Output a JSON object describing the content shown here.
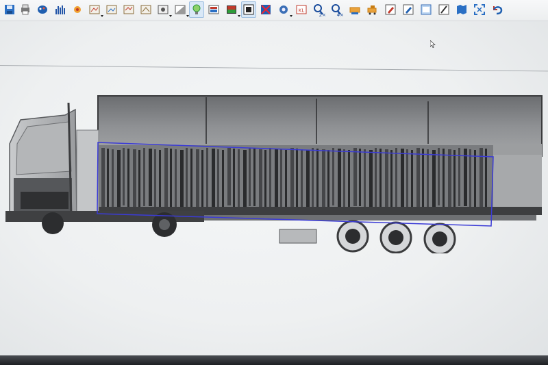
{
  "toolbar": {
    "buttons": [
      {
        "name": "save-icon",
        "color": "#2a6fc4"
      },
      {
        "name": "print-icon",
        "color": "#555"
      },
      {
        "name": "palette-icon",
        "color": "#1f5fb0"
      },
      {
        "name": "histogram-icon",
        "color": "#2456a8"
      },
      {
        "name": "edge-enhance-icon",
        "color": "#c0392b"
      },
      {
        "name": "filter-1-icon",
        "color": "#8a6d3b"
      },
      {
        "name": "filter-2-icon",
        "color": "#8a6d3b"
      },
      {
        "name": "filter-3-icon",
        "color": "#8a6d3b"
      },
      {
        "name": "filter-4-icon",
        "color": "#8a6d3b"
      },
      {
        "name": "sharpen-icon",
        "color": "#555"
      },
      {
        "name": "contrast-icon",
        "color": "#555"
      },
      {
        "name": "lightbulb-icon",
        "color": "#2e9d3a"
      },
      {
        "name": "color-map-icon",
        "color": "#c0392b"
      },
      {
        "name": "pseudo-color-icon",
        "color": "#c0392b"
      },
      {
        "name": "invert-icon",
        "color": "#222"
      },
      {
        "name": "organic-filter-icon",
        "color": "#b03a2e"
      },
      {
        "name": "gear-icon",
        "color": "#3b6fb6"
      },
      {
        "name": "kl-icon",
        "color": "#c0392b"
      },
      {
        "name": "zoom-2x-icon",
        "color": "#1a4c9c"
      },
      {
        "name": "zoom-4x-icon",
        "color": "#1a4c9c"
      },
      {
        "name": "scanner-icon",
        "color": "#c77c12"
      },
      {
        "name": "vehicle-icon",
        "color": "#c77c12"
      },
      {
        "name": "annotate-icon",
        "color": "#555"
      },
      {
        "name": "edit-note-icon",
        "color": "#555"
      },
      {
        "name": "window-icon",
        "color": "#3b6fb6"
      },
      {
        "name": "pencil-icon",
        "color": "#555"
      },
      {
        "name": "map-icon",
        "color": "#2a6fc4"
      },
      {
        "name": "fullscreen-icon",
        "color": "#2a6fc4"
      },
      {
        "name": "undo-icon",
        "color": "#1f5fb0"
      }
    ],
    "zoom_2x_label": "2×",
    "zoom_4x_label": "4×",
    "kl_label": "KL"
  },
  "viewer": {
    "image_subject": "x-ray-scan-of-truck-and-trailer",
    "selection_box_color": "#3b3bd6",
    "background_color": "#eef0f1"
  }
}
